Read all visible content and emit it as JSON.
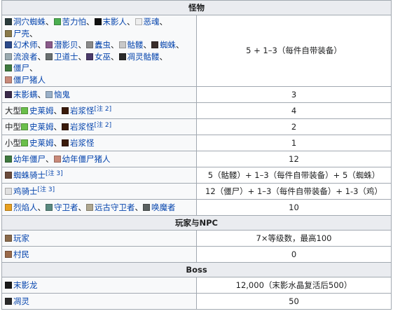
{
  "sections": {
    "monsters": "怪物",
    "players": "玩家与NPC",
    "boss": "Boss"
  },
  "rows": {
    "r1": {
      "names": [
        "洞穴蜘蛛",
        "苦力怕",
        "末影人",
        "恶魂",
        "尸壳",
        "幻术师",
        "潜影贝",
        "蠹虫",
        "骷髅",
        "蜘蛛",
        "流浪者",
        "卫道士",
        "女巫",
        "凋灵骷髅",
        "僵尸",
        "僵尸猪人"
      ],
      "value": "5 + 1–3（每件自带装备）"
    },
    "r2": {
      "names": [
        "末影螨",
        "恼鬼"
      ],
      "value": "3"
    },
    "r3": {
      "prefix": "大型",
      "names": [
        "史莱姆",
        "岩浆怪"
      ],
      "note": "[注 2]",
      "value": "4"
    },
    "r4": {
      "prefix": "中型",
      "names": [
        "史莱姆",
        "岩浆怪"
      ],
      "note": "[注 2]",
      "value": "2"
    },
    "r5": {
      "prefix": "小型",
      "names": [
        "史莱姆",
        "岩浆怪"
      ],
      "value": "1"
    },
    "r6": {
      "names": [
        "幼年僵尸",
        "幼年僵尸猪人"
      ],
      "value": "12"
    },
    "r7": {
      "names": [
        "蜘蛛骑士"
      ],
      "note": "[注 3]",
      "value": "5（骷髅）+ 1–3（每件自带装备）+ 5（蜘蛛）"
    },
    "r8": {
      "names": [
        "鸡骑士"
      ],
      "note": "[注 3]",
      "value": "12（僵尸）+ 1–3（每件自带装备）+ 1-3（鸡）"
    },
    "r9": {
      "names": [
        "烈焰人",
        "守卫者",
        "远古守卫者",
        "唤魔者"
      ],
      "value": "10"
    },
    "r10": {
      "names": [
        "玩家"
      ],
      "value": "7×等级数，最高100"
    },
    "r11": {
      "names": [
        "村民"
      ],
      "value": "0"
    },
    "r12": {
      "names": [
        "末影龙"
      ],
      "value": "12,000（末影水晶复活后500）"
    },
    "r13": {
      "names": [
        "凋灵"
      ],
      "value": "50"
    }
  },
  "separator": "、",
  "icons": {
    "r1": [
      {
        "name": "cave-spider-icon",
        "color": "#2a3b3b"
      },
      {
        "name": "creeper-icon",
        "color": "#4caf50"
      },
      {
        "name": "enderman-icon",
        "color": "#111111"
      },
      {
        "name": "ghast-icon",
        "color": "#eeeeee"
      },
      {
        "name": "husk-icon",
        "color": "#8a7a4a"
      },
      {
        "name": "illusioner-icon",
        "color": "#2c4a8a"
      },
      {
        "name": "shulker-icon",
        "color": "#8a5a8a"
      },
      {
        "name": "silverfish-icon",
        "color": "#8a8a8a"
      },
      {
        "name": "skeleton-icon",
        "color": "#c8c8c8"
      },
      {
        "name": "spider-icon",
        "color": "#3a2e2a"
      },
      {
        "name": "stray-icon",
        "color": "#9aaab0"
      },
      {
        "name": "vindicator-icon",
        "color": "#6a7070"
      },
      {
        "name": "witch-icon",
        "color": "#4a3a6a"
      },
      {
        "name": "wither-skeleton-icon",
        "color": "#2a2a2a"
      },
      {
        "name": "zombie-icon",
        "color": "#3f7a3f"
      },
      {
        "name": "zombie-pigman-icon",
        "color": "#c98a7a"
      }
    ],
    "r2": [
      {
        "name": "endermite-icon",
        "color": "#3a2a4a"
      },
      {
        "name": "vex-icon",
        "color": "#9ab0c8"
      }
    ],
    "slime": {
      "name": "slime-icon",
      "color": "#6abf4a"
    },
    "magma": {
      "name": "magma-cube-icon",
      "color": "#3a1a0a"
    },
    "r6": [
      {
        "name": "baby-zombie-icon",
        "color": "#3f7a3f"
      },
      {
        "name": "baby-zombie-pigman-icon",
        "color": "#c98a7a"
      }
    ],
    "r7": [
      {
        "name": "spider-jockey-icon",
        "color": "#6a4a3a"
      }
    ],
    "r8": [
      {
        "name": "chicken-jockey-icon",
        "color": "#e0e0e0"
      }
    ],
    "r9": [
      {
        "name": "blaze-icon",
        "color": "#e8a020"
      },
      {
        "name": "guardian-icon",
        "color": "#5a8a80"
      },
      {
        "name": "elder-guardian-icon",
        "color": "#b0a890"
      },
      {
        "name": "evoker-icon",
        "color": "#5a6060"
      }
    ],
    "r10": [
      {
        "name": "player-icon",
        "color": "#8a6a4a"
      }
    ],
    "r11": [
      {
        "name": "villager-icon",
        "color": "#9a6a4a"
      }
    ],
    "r12": [
      {
        "name": "ender-dragon-icon",
        "color": "#1a1a1a"
      }
    ],
    "r13": [
      {
        "name": "wither-icon",
        "color": "#2a2a2a"
      }
    ]
  }
}
